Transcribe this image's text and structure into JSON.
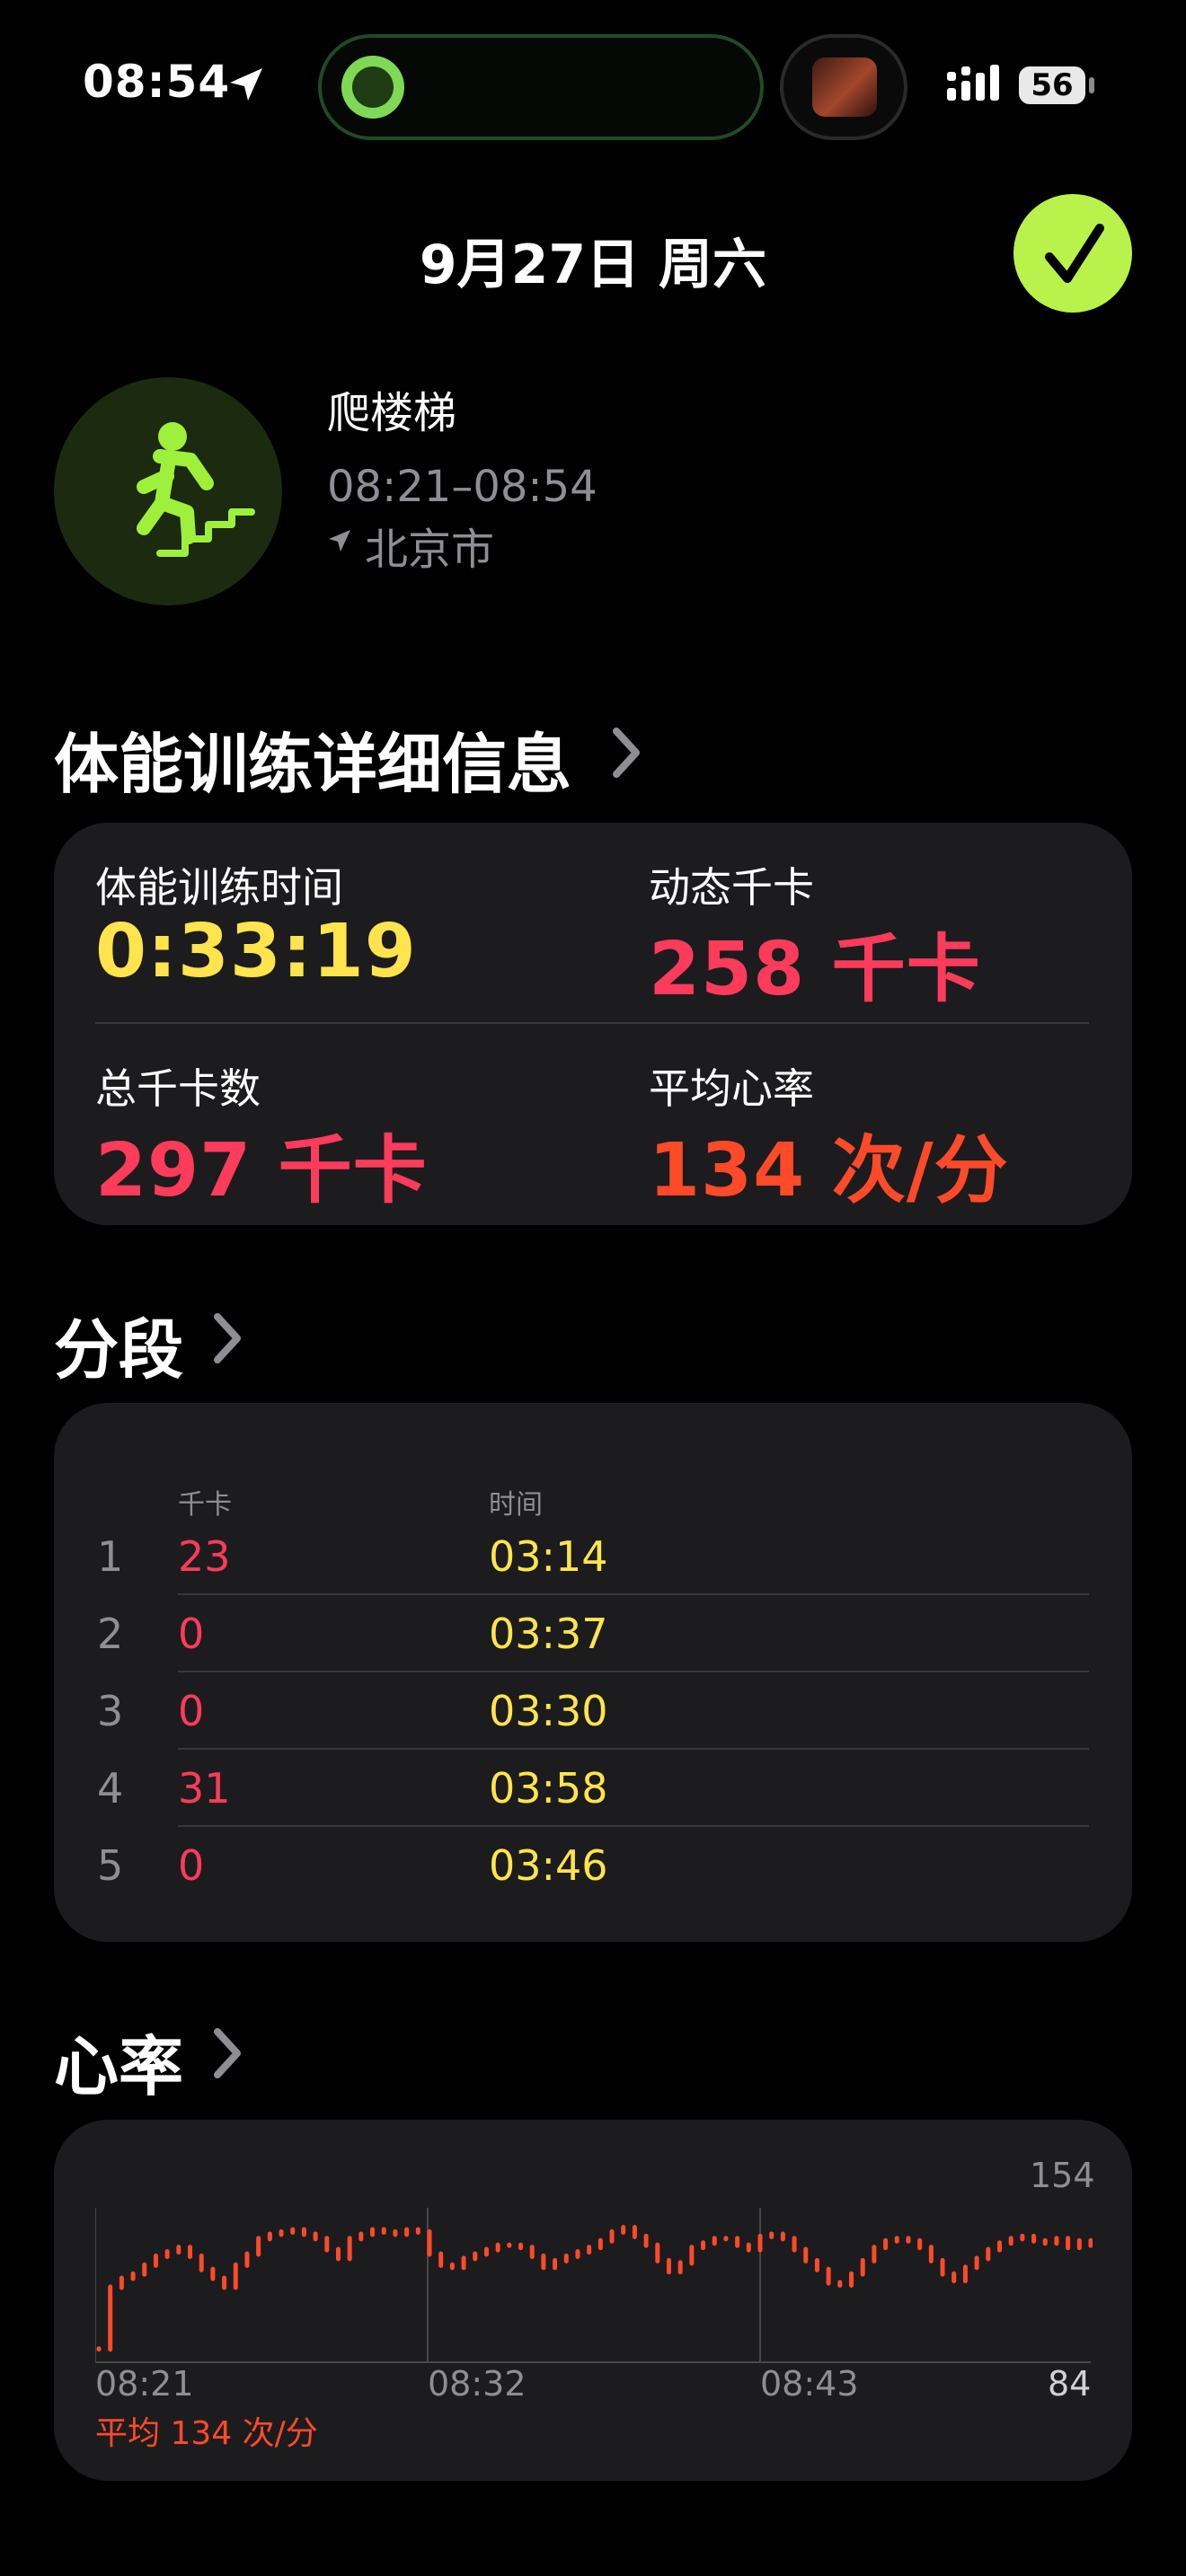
{
  "status_bar": {
    "time": "08:54",
    "battery": "56"
  },
  "header": {
    "date": "9月27日 周六"
  },
  "workout": {
    "name": "爬楼梯",
    "time_range": "08:21–08:54",
    "location": "北京市"
  },
  "details": {
    "title": "体能训练详细信息",
    "metrics": [
      {
        "label": "体能训练时间",
        "value": "0:33:19",
        "color": "#ffe44d"
      },
      {
        "label": "动态千卡",
        "value": "258 千卡",
        "color": "#ff3b5c"
      },
      {
        "label": "总千卡数",
        "value": "297 千卡",
        "color": "#ff3b5c"
      },
      {
        "label": "平均心率",
        "value": "134 次/分",
        "color": "#ff4a2a"
      }
    ]
  },
  "splits": {
    "title": "分段",
    "col_calories": "千卡",
    "col_time": "时间",
    "rows": [
      {
        "index": "1",
        "calories": "23",
        "time": "03:14"
      },
      {
        "index": "2",
        "calories": "0",
        "time": "03:37"
      },
      {
        "index": "3",
        "calories": "0",
        "time": "03:30"
      },
      {
        "index": "4",
        "calories": "31",
        "time": "03:58"
      },
      {
        "index": "5",
        "calories": "0",
        "time": "03:46"
      }
    ]
  },
  "heart_rate": {
    "title": "心率",
    "average_label": "平均 134 次/分",
    "ymax_label": "154",
    "ymin_label": "84",
    "x_labels": [
      "08:21",
      "08:32",
      "08:43"
    ],
    "chart_data": {
      "type": "line",
      "ylim": [
        84,
        154
      ],
      "y_tick_labels": [
        "154",
        "84"
      ],
      "x_tick_labels": [
        "08:21",
        "08:32",
        "08:43"
      ],
      "series": [
        {
          "values": [
            90,
            118,
            122,
            124,
            128,
            132,
            134,
            136,
            132,
            126,
            122,
            118,
            128,
            133,
            140,
            142,
            143,
            144,
            142,
            140,
            135,
            131,
            140,
            142,
            144,
            143,
            142,
            144,
            143,
            133,
            128,
            127,
            131,
            133,
            135,
            137,
            137,
            136,
            132,
            127,
            130,
            132,
            134,
            136,
            139,
            143,
            145,
            141,
            137,
            130,
            125,
            129,
            136,
            138,
            140,
            140,
            137,
            135,
            141,
            142,
            140,
            135,
            130,
            126,
            120,
            119,
            124,
            130,
            136,
            139,
            140,
            139,
            136,
            130,
            124,
            121,
            127,
            131,
            135,
            138,
            140,
            141,
            139,
            138,
            140,
            136,
            139,
            137
          ]
        }
      ],
      "color": "#ff4a2a"
    }
  }
}
